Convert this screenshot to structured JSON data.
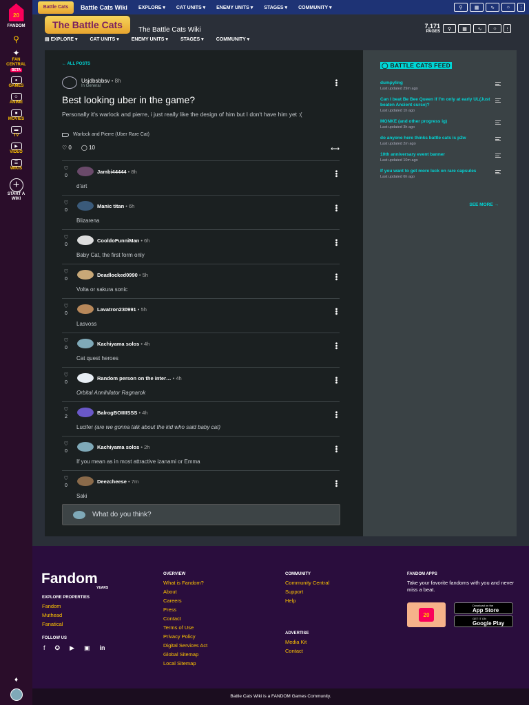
{
  "global_nav": {
    "logo_number": "20",
    "fandom_label": "FANDOM",
    "items": [
      {
        "label": "FAN CENTRAL",
        "badge": "BETA"
      },
      {
        "label": "GAMES"
      },
      {
        "label": "ANIME"
      },
      {
        "label": "MOVIES"
      },
      {
        "label": "TV"
      },
      {
        "label": "VIDEO"
      },
      {
        "label": "WIKIS"
      }
    ],
    "start_wiki": "START A WIKI"
  },
  "topbar": {
    "wiki_name": "Battle Cats Wiki",
    "logo_text": "Battle Cats",
    "nav": [
      "EXPLORE",
      "CAT UNITS",
      "ENEMY UNITS",
      "STAGES",
      "COMMUNITY"
    ]
  },
  "wiki_header": {
    "logo_text": "The Battle Cats",
    "title": "The Battle Cats Wiki",
    "pages_count": "7,171",
    "pages_label": "PAGES",
    "nav": [
      "EXPLORE",
      "CAT UNITS",
      "ENEMY UNITS",
      "STAGES",
      "COMMUNITY"
    ]
  },
  "post": {
    "all_posts": "ALL POSTS",
    "author": "Usjdbsbbsv",
    "time": "8h",
    "category": "In General",
    "title": "Best looking uber in the game?",
    "body": "Personally it's warlock and pierre, i just really like the design of him but I don't have him yet :(",
    "tag": "Warlock and Pierre (Uber Rare Cat)",
    "likes": "0",
    "comments": "10"
  },
  "replies": [
    {
      "name": "Jambi44444",
      "time": "8h",
      "likes": "0",
      "text": "d'art",
      "text_italic": ""
    },
    {
      "name": "Manic titan",
      "time": "6h",
      "likes": "0",
      "text": "Blizarena",
      "text_italic": ""
    },
    {
      "name": "CooldoFunniMan",
      "time": "6h",
      "likes": "0",
      "text": "Baby Cat, the first form only",
      "text_italic": ""
    },
    {
      "name": "Deadlocked0990",
      "time": "5h",
      "likes": "0",
      "text": "Volta or sakura sonic",
      "text_italic": ""
    },
    {
      "name": "Lavatron230991",
      "time": "5h",
      "likes": "0",
      "text": "Lasvoss",
      "text_italic": ""
    },
    {
      "name": "Kachiyama solos",
      "time": "4h",
      "likes": "0",
      "text": "Cat quest heroes",
      "text_italic": ""
    },
    {
      "name": "Random person on the inter…",
      "time": "4h",
      "likes": "0",
      "text": "",
      "text_italic": "Orbital Annihilator Ragnarok"
    },
    {
      "name": "BalrogBOIIIISSS",
      "time": "4h",
      "likes": "2",
      "text": "Lucifer ",
      "text_italic": "(are we gonna talk about the kid who said baby cat)"
    },
    {
      "name": "Kachiyama solos",
      "time": "2h",
      "likes": "0",
      "text": "If you mean as in most attractive izanami or Emma",
      "text_italic": ""
    },
    {
      "name": "Deezcheese",
      "time": "7m",
      "likes": "0",
      "text": "Saki",
      "text_italic": ""
    }
  ],
  "comment_box": {
    "placeholder": "What do you think?"
  },
  "feed": {
    "title": "BATTLE CATS FEED",
    "items": [
      {
        "title": "dumpyling",
        "time": "Last updated 29m ago"
      },
      {
        "title": "Can I beat Be Bee Queen if I'm only at early UL(Just beaten Ancient curse)?",
        "time": "Last updated 1h ago"
      },
      {
        "title": "MONKE (and other progress ig)",
        "time": "Last updated 3h ago"
      },
      {
        "title": "do anyone here thinks battle cats is p2w",
        "time": "Last updated 2m ago"
      },
      {
        "title": "10th anniversary event banner",
        "time": "Last updated 10m ago"
      },
      {
        "title": "If you want to get more luck on rare capsules",
        "time": "Last updated 6h ago"
      }
    ],
    "see_more": "SEE MORE"
  },
  "footer": {
    "logo": "Fandom",
    "years": "YEARS",
    "explore_head": "EXPLORE PROPERTIES",
    "explore": [
      "Fandom",
      "Muthead",
      "Fanatical"
    ],
    "follow_head": "FOLLOW US",
    "overview_head": "OVERVIEW",
    "overview": [
      "What is Fandom?",
      "About",
      "Careers",
      "Press",
      "Contact",
      "Terms of Use",
      "Privacy Policy",
      "Digital Services Act",
      "Global Sitemap",
      "Local Sitemap"
    ],
    "community_head": "COMMUNITY",
    "community": [
      "Community Central",
      "Support",
      "Help"
    ],
    "advertise_head": "ADVERTISE",
    "advertise": [
      "Media Kit",
      "Contact"
    ],
    "apps_head": "FANDOM APPS",
    "apps_text": "Take your favorite fandoms with you and never miss a beat.",
    "app_store_small": "Download on the",
    "app_store": "App Store",
    "google_small": "GET IT ON",
    "google": "Google Play",
    "bottom": "Battle Cats Wiki is a FANDOM Games Community."
  }
}
